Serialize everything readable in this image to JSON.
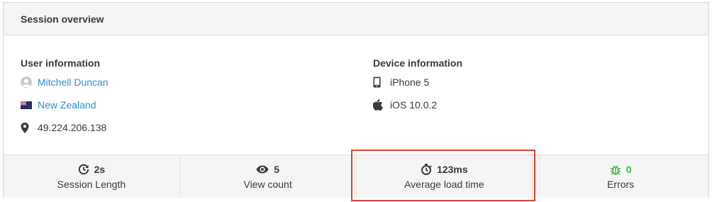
{
  "header": {
    "title": "Session overview"
  },
  "user_info": {
    "title": "User information",
    "name": "Mitchell Duncan",
    "country": "New Zealand",
    "ip": "49.224.206.138"
  },
  "device_info": {
    "title": "Device information",
    "device": "iPhone 5",
    "os": "iOS 10.0.2"
  },
  "stats": [
    {
      "value": "2s",
      "label": "Session Length",
      "icon": "session-length-icon"
    },
    {
      "value": "5",
      "label": "View count",
      "icon": "eye-icon"
    },
    {
      "value": "123ms",
      "label": "Average load time",
      "icon": "stopwatch-icon"
    },
    {
      "value": "0",
      "label": "Errors",
      "icon": "bug-icon"
    }
  ],
  "colors": {
    "link": "#2a8fd6",
    "errors": "#3cb94b",
    "highlight": "#e0412f"
  }
}
